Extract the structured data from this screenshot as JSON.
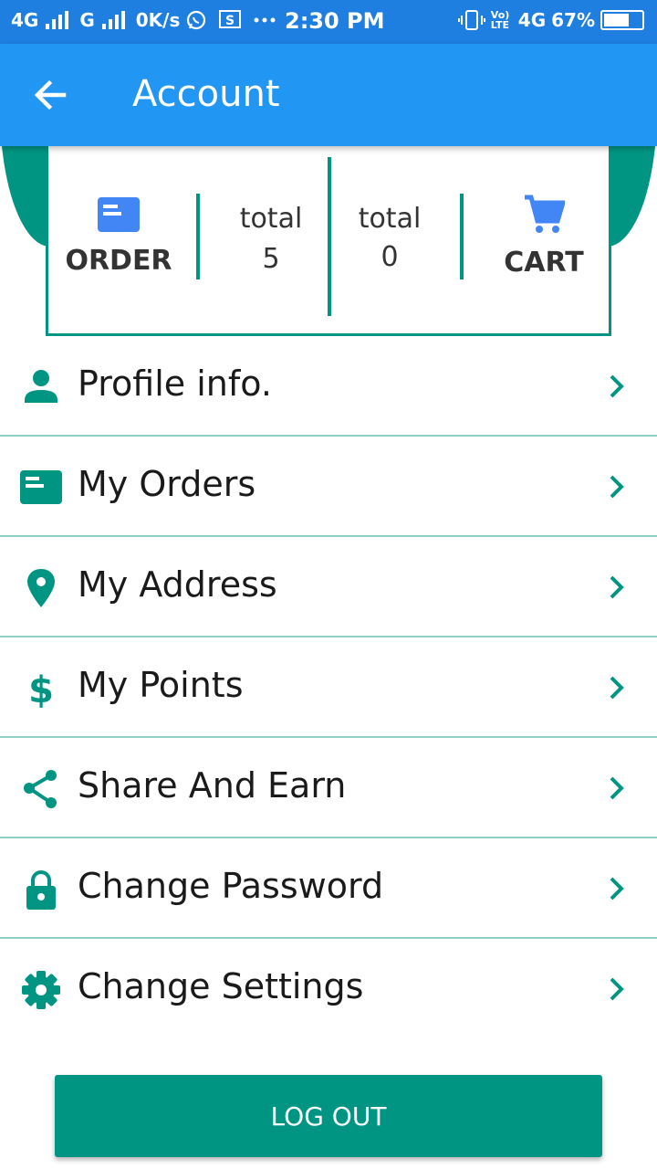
{
  "status_bar": {
    "net1": "4G",
    "net2": "G",
    "speed": "0K/s",
    "time": "2:30 PM",
    "volte": "Vo) LTE",
    "net3": "4G",
    "battery": "67%",
    "battery_level": 0.67
  },
  "app_bar": {
    "title": "Account"
  },
  "summary": {
    "order_label": "ORDER",
    "orders_total_label": "total",
    "orders_total_value": "5",
    "cart_total_label": "total",
    "cart_total_value": "0",
    "cart_label": "CART",
    "order_icon_color": "#4285f4",
    "cart_icon_color": "#4285f4"
  },
  "menu": [
    {
      "label": "Profile info.",
      "icon": "person-icon"
    },
    {
      "label": "My Orders",
      "icon": "orders-icon"
    },
    {
      "label": "My Address",
      "icon": "location-pin-icon"
    },
    {
      "label": "My Points",
      "icon": "dollar-icon"
    },
    {
      "label": "Share And Earn",
      "icon": "share-icon"
    },
    {
      "label": "Change Password",
      "icon": "lock-icon"
    },
    {
      "label": "Change Settings",
      "icon": "gear-icon"
    }
  ],
  "logout_label": "LOG OUT",
  "colors": {
    "primary": "#2196f3",
    "status": "#1f7fe0",
    "accent": "#009583",
    "divider": "#8fcfc5"
  }
}
